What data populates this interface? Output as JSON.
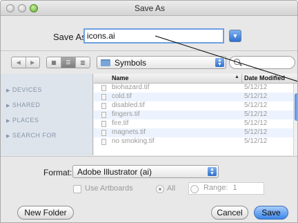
{
  "window": {
    "title": "Save As"
  },
  "save": {
    "label": "Save As:",
    "value": "icons.ai"
  },
  "toolbar": {
    "nav": [
      "◀",
      "▶"
    ],
    "views": [
      "▦",
      "☰",
      "▥"
    ],
    "folder": "Symbols",
    "search_glyph": "Q"
  },
  "sidebar": {
    "items": [
      {
        "label": "DEVICES"
      },
      {
        "label": "SHARED"
      },
      {
        "label": "PLACES"
      },
      {
        "label": "SEARCH FOR"
      }
    ]
  },
  "files": {
    "columns": {
      "name": "Name",
      "date": "Date Modified",
      "sort_glyph": "▲"
    },
    "rows": [
      {
        "name": "biohazard.tif",
        "date": "5/12/12"
      },
      {
        "name": "cold.tif",
        "date": "5/12/12"
      },
      {
        "name": "disabled.tif",
        "date": "5/12/12"
      },
      {
        "name": "fingers.tif",
        "date": "5/12/12"
      },
      {
        "name": "fire.tif",
        "date": "5/12/12"
      },
      {
        "name": "magnets.tif",
        "date": "5/12/12"
      },
      {
        "name": "no smoking.tif",
        "date": "5/12/12"
      }
    ]
  },
  "options": {
    "format_label": "Format:",
    "format_value": "Adobe Illustrator (ai)",
    "use_artboards": "Use Artboards",
    "all": "All",
    "range": "Range:",
    "range_value": "1"
  },
  "buttons": {
    "new_folder": "New Folder",
    "cancel": "Cancel",
    "save": "Save"
  },
  "colors": {
    "accent": "#3c86e8",
    "sidebar_bg": "#dde4ec",
    "row_alt": "#edf3fe"
  }
}
